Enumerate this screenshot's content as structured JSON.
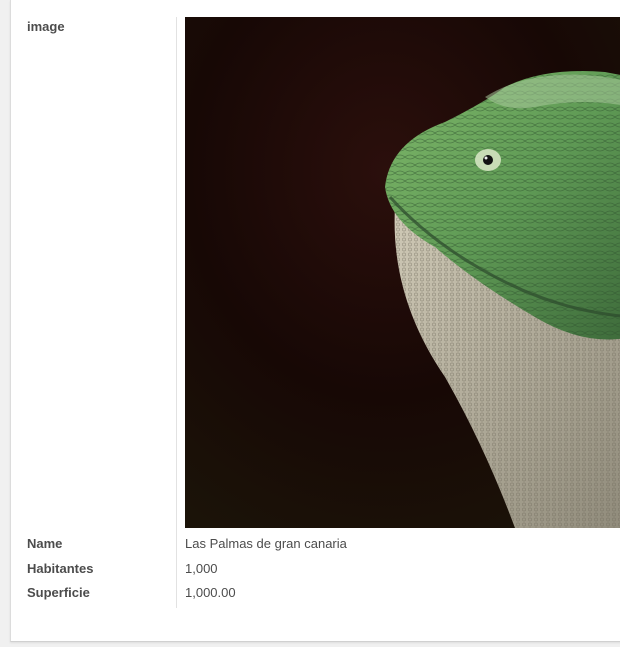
{
  "form": {
    "fields": [
      {
        "label": "image"
      },
      {
        "label": "Name",
        "value": "Las Palmas de gran canaria"
      },
      {
        "label": "Habitantes",
        "value": "1,000"
      },
      {
        "label": "Superficie",
        "value": "1,000.00"
      }
    ]
  },
  "image": {
    "subject": "green-iguana-photo",
    "colors": {
      "background": "#1a0806",
      "scales_light": "#8fc27a",
      "scales_dark": "#3f6a3a",
      "throat": "#b9b6a6"
    }
  }
}
